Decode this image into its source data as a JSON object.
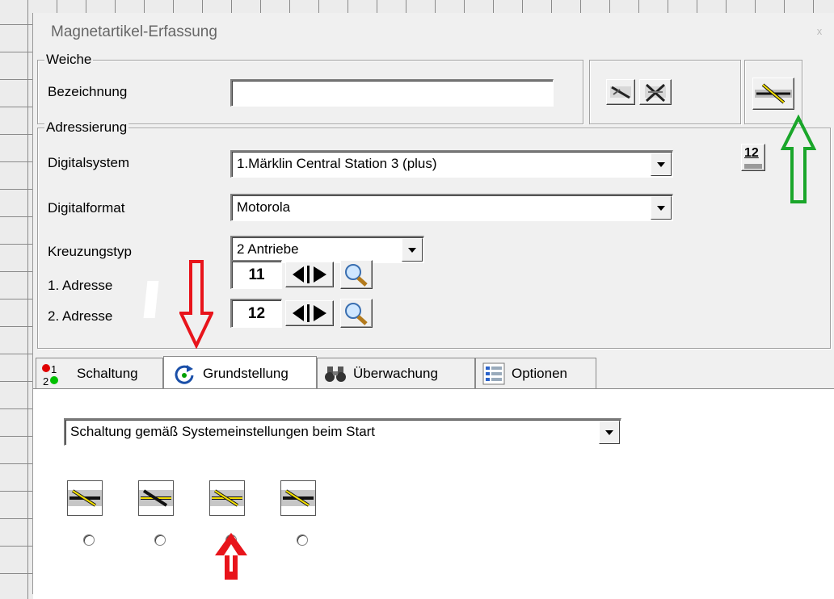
{
  "window": {
    "title": "Magnetartikel-Erfassung",
    "close_label": "x"
  },
  "weiche": {
    "legend": "Weiche",
    "bezeichnung_label": "Bezeichnung",
    "bezeichnung_value": ""
  },
  "adressierung": {
    "legend": "Adressierung",
    "digitalsystem_label": "Digitalsystem",
    "digitalsystem_value": "1.Märklin Central Station 3 (plus)",
    "digitalformat_label": "Digitalformat",
    "digitalformat_value": "Motorola",
    "kreuzungstyp_label": "Kreuzungstyp",
    "kreuzungstyp_value": "2 Antriebe",
    "adresse1_label": "1. Adresse",
    "adresse1_value": "11",
    "adresse2_label": "2. Adresse",
    "adresse2_value": "12",
    "address_badge": "12"
  },
  "tabs": [
    {
      "label": "Schaltung",
      "icon": "red-green-12-icon"
    },
    {
      "label": "Grundstellung",
      "icon": "rotate-arrow-icon"
    },
    {
      "label": "Überwachung",
      "icon": "binoculars-icon"
    },
    {
      "label": "Optionen",
      "icon": "options-list-icon"
    }
  ],
  "active_tab": "Grundstellung",
  "grundstellung": {
    "mode_value": "Schaltung gemäß Systemeinstellungen beim Start",
    "positions": [
      {
        "checked": false
      },
      {
        "checked": false
      },
      {
        "checked": true
      },
      {
        "checked": false
      }
    ]
  },
  "annotations": {
    "arrow_color_red": "#e8141b",
    "arrow_color_green": "#1aa62a"
  }
}
